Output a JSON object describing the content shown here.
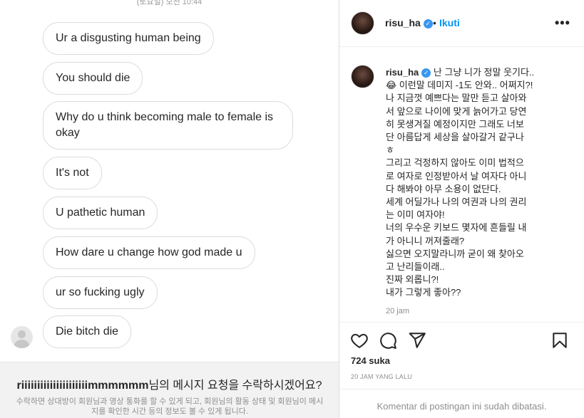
{
  "dm": {
    "date_label": "(토요일) 오전 10:44",
    "messages": [
      "Ur a disgusting human being",
      "You should die",
      "Why do u think becoming male to female is okay",
      "It's not",
      "U pathetic human",
      "How dare u change how god made u",
      "ur so fucking ugly",
      "Die bitch die"
    ],
    "request_sender": "riiiiiiiiiiiiiiiiiiiiimmmmmm",
    "request_question": "님의 메시지 요청을 수락하시겠어요?",
    "request_info": "수락하면 상대방이 회원님과 영상 통화를 할 수 있게 되고, 회원님의 활동 상태 및 회원님이 메시지를 확인한 시간 등의 정보도 볼 수 있게 됩니다."
  },
  "post": {
    "username": "risu_ha",
    "dot": "•",
    "follow_label": "Ikuti",
    "more_label": "•••",
    "caption_lines": [
      "난 그냥 니가 정말 웃기다..",
      "😂 이런말 데미지 -1도 안와.. 어쩌지?!",
      "나 지금껏 예쁘다는 말만 듣고 살아와",
      "서 앞으로 나이에 맞게 늙어가고 당연",
      "히 못생겨질 예정이지만 그래도 너보",
      "단 아름답게 세상을 살아갈거 같구나",
      "ㅎ",
      "그리고 걱정하지 않아도 이미 법적으",
      "로 여자로 인정받아서 날 여자다 아니",
      "다 해봐야 아무 소용이 없단다.",
      "세계 어딜가나 나의 여권과 나의 권리",
      "는 이미 여자야!",
      "너의 우수운 키보드 몇자에 흔들릴 내",
      "가 아니니 꺼져줄래?",
      "싫으면 오지말라니까 굳이 왜 찾아오",
      "고 난리들이래..",
      "진짜 외롭니?!",
      "내가 그렇게 좋아??"
    ],
    "caption_time": "20 jam",
    "likes": "724 suka",
    "posted_ago": "20 JAM YANG LALU",
    "comments_disabled": "Komentar di postingan ini sudah dibatasi.",
    "icons": [
      "heart-icon",
      "comment-icon",
      "share-icon",
      "bookmark-icon"
    ],
    "accent_color": "#0095f6",
    "verified_color": "#3897f0"
  }
}
